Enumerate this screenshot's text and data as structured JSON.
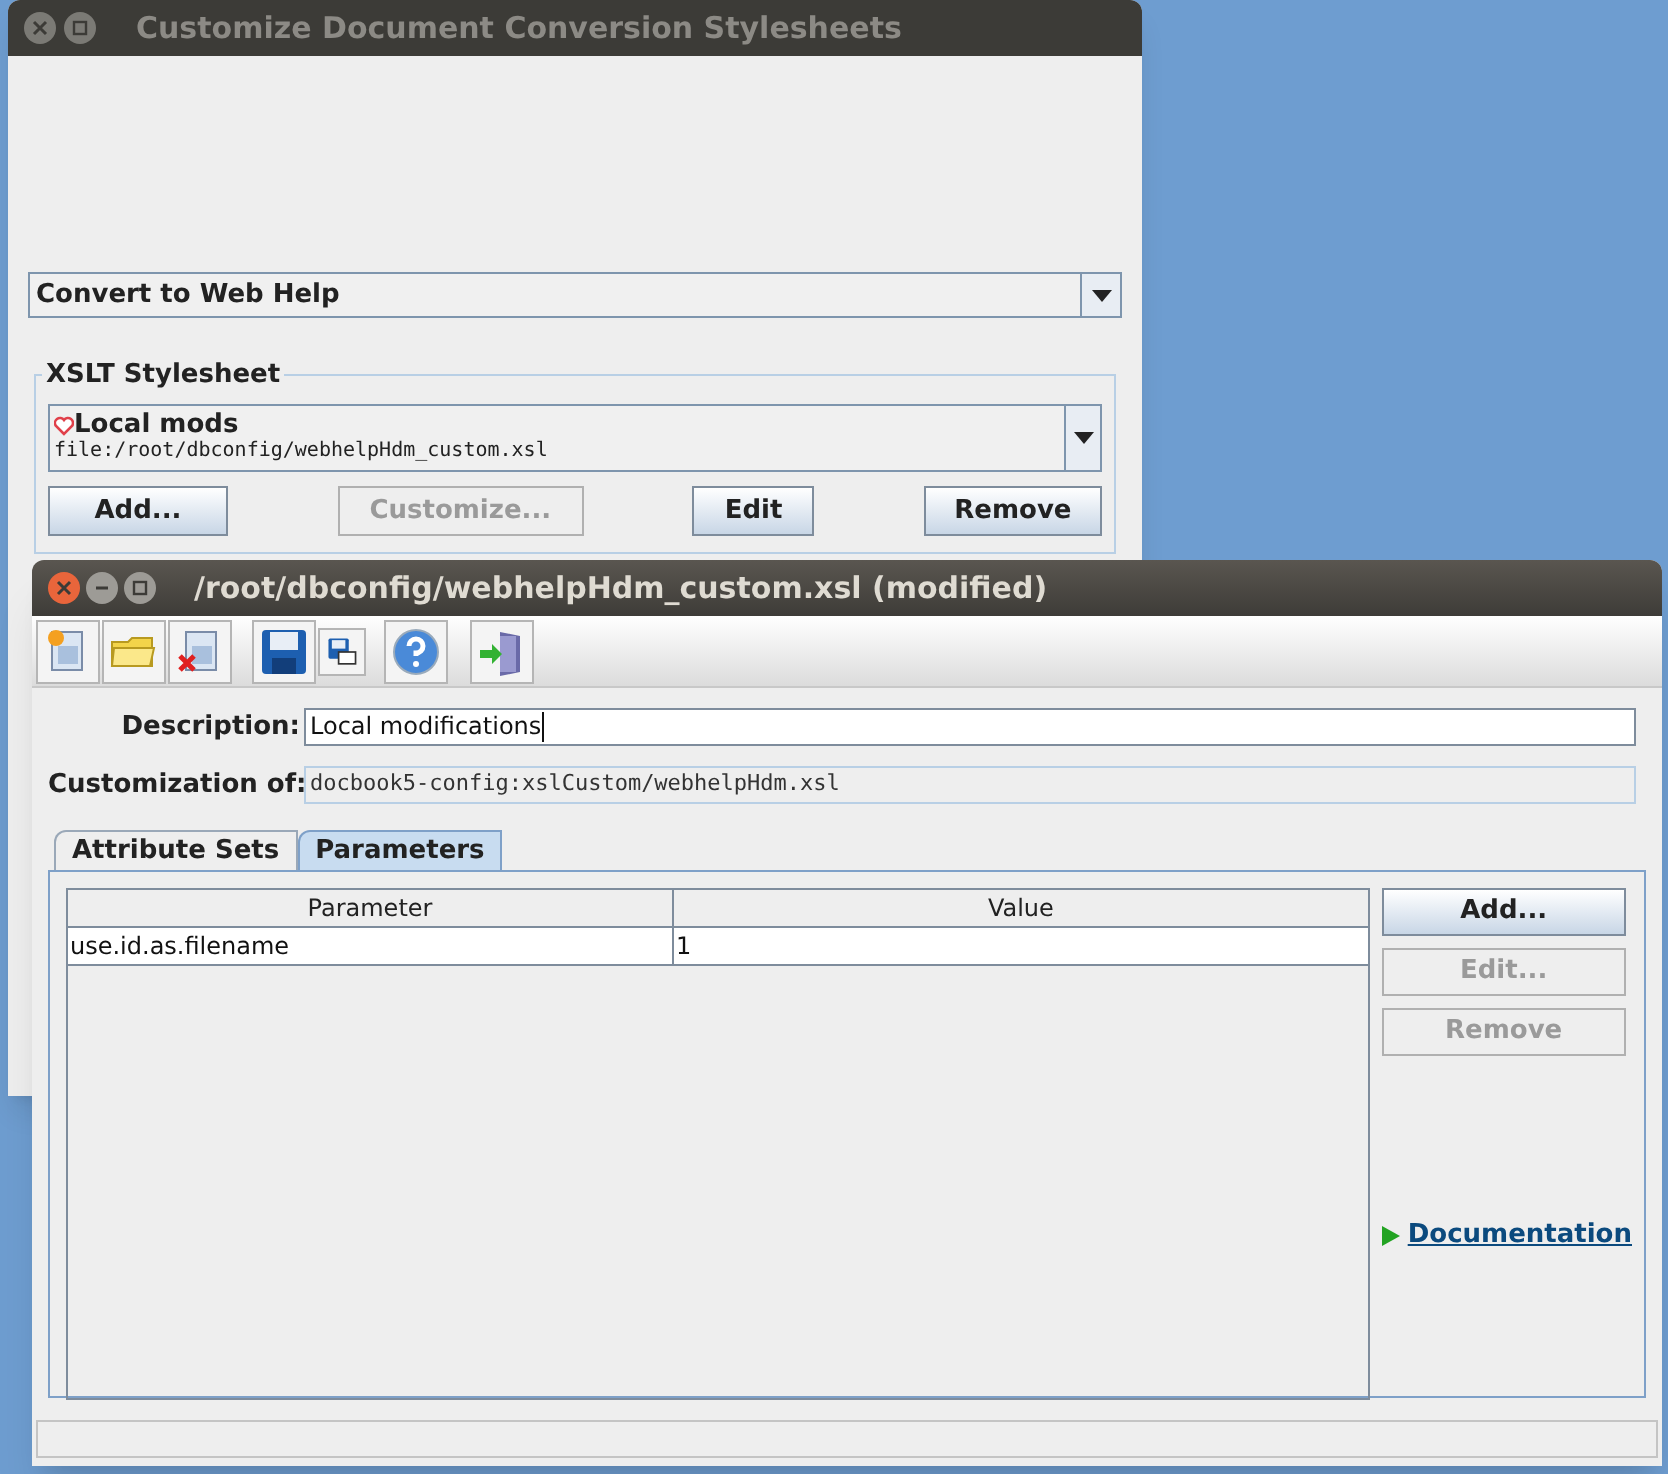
{
  "back_window": {
    "title": "Customize Document Conversion Stylesheets",
    "conversion": {
      "value": "Convert to Web Help"
    },
    "stylesheet_group": {
      "label": "XSLT Stylesheet",
      "selection": {
        "name": "Local mods",
        "path": "file:/root/dbconfig/webhelpHdm_custom.xsl"
      },
      "buttons": [
        {
          "label": "Add...",
          "disabled": false
        },
        {
          "label": "Customize...",
          "disabled": true
        },
        {
          "label": "Edit",
          "disabled": false
        },
        {
          "label": "Remove",
          "disabled": false
        }
      ]
    }
  },
  "editor_window": {
    "title": "/root/dbconfig/webhelpHdm_custom.xsl (modified)",
    "toolbar": [
      {
        "kind": "new"
      },
      {
        "kind": "open"
      },
      {
        "kind": "delete"
      },
      {
        "kind": "save"
      },
      {
        "kind": "save_as"
      },
      {
        "kind": "help"
      },
      {
        "kind": "exit"
      }
    ],
    "description": {
      "label": "Description:",
      "value": "Local modifications"
    },
    "customization_of": {
      "label": "Customization of:",
      "value": "docbook5-config:xslCustom/webhelpHdm.xsl"
    },
    "tabs": [
      {
        "label": "Attribute Sets",
        "selected": false
      },
      {
        "label": "Parameters",
        "selected": true
      }
    ],
    "table": {
      "columns": [
        "Parameter",
        "Value"
      ],
      "rows": [
        [
          "use.id.as.filename",
          "1"
        ]
      ]
    },
    "buttons": [
      {
        "label": "Add...",
        "disabled": false
      },
      {
        "label": "Edit...",
        "disabled": true
      },
      {
        "label": "Remove",
        "disabled": true
      }
    ],
    "documentation_link": "Documentation"
  }
}
